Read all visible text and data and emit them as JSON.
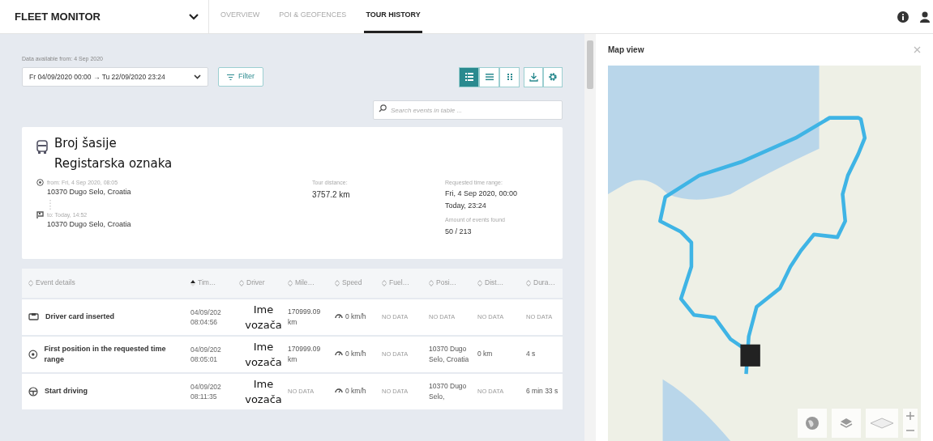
{
  "header": {
    "app_title": "FLEET MONITOR",
    "tabs": [
      {
        "label": "OVERVIEW",
        "selected": false
      },
      {
        "label": "POI & GEOFENCES",
        "selected": false
      },
      {
        "label": "TOUR HISTORY",
        "selected": true
      }
    ]
  },
  "toolbar": {
    "data_available": "Data available from: 4 Sep 2020",
    "date_range": "Fr 04/09/2020 00:00 → Tu 22/09/2020 23:24",
    "filter": "Filter",
    "view_modes": [
      {
        "kind": "detailed",
        "selected": true
      },
      {
        "kind": "list",
        "selected": false
      },
      {
        "kind": "grid",
        "selected": false
      }
    ],
    "search_placeholder": "Search events in table ..."
  },
  "summary": {
    "vehicle_lines": [
      "Broj šasije",
      "Registarska oznaka"
    ],
    "from_label": "from: Fri, 4 Sep 2020, 08:05",
    "from_place": "10370 Dugo Selo, Croatia",
    "to_label": "to: Today, 14:52",
    "to_place": "10370 Dugo Selo, Croatia",
    "distance_label": "Tour distance:",
    "distance": "3757.2 km",
    "range_label": "Requested time range:",
    "range_start": "Fri, 4 Sep 2020, 00:00",
    "range_end": "Today, 23:24",
    "events_label": "Amount of events found",
    "events": "50 / 213"
  },
  "table": {
    "columns": [
      {
        "label": "Event details",
        "sorted": false
      },
      {
        "label": "Tim…",
        "sorted": true
      },
      {
        "label": "Driver",
        "sorted": false
      },
      {
        "label": "Mile…",
        "sorted": false
      },
      {
        "label": "Speed",
        "sorted": false
      },
      {
        "label": "Fuel…",
        "sorted": false
      },
      {
        "label": "Posi…",
        "sorted": false
      },
      {
        "label": "Dist…",
        "sorted": false
      },
      {
        "label": "Dura…",
        "sorted": false
      }
    ],
    "rows": [
      {
        "kind": "card",
        "cells": [
          {
            "kind": "event",
            "text": "Driver card inserted"
          },
          {
            "kind": "datetime",
            "date": "04/09/202",
            "time": "08:04:56"
          },
          {
            "kind": "driver",
            "text": "Ime vozača"
          },
          {
            "kind": "value",
            "text": "170999.09 km"
          },
          {
            "kind": "speed",
            "text": "0 km/h"
          },
          {
            "kind": "no_data",
            "text": "NO DATA"
          },
          {
            "kind": "no_data",
            "text": "NO DATA"
          },
          {
            "kind": "no_data",
            "text": "NO DATA"
          },
          {
            "kind": "no_data",
            "text": "NO DATA"
          }
        ]
      },
      {
        "kind": "position",
        "cells": [
          {
            "kind": "event",
            "text": "First position in the requested time range"
          },
          {
            "kind": "datetime",
            "date": "04/09/202",
            "time": "08:05:01"
          },
          {
            "kind": "driver",
            "text": "Ime vozača"
          },
          {
            "kind": "value",
            "text": "170999.09 km"
          },
          {
            "kind": "speed",
            "text": "0 km/h"
          },
          {
            "kind": "no_data",
            "text": "NO DATA"
          },
          {
            "kind": "value",
            "text": "10370 Dugo Selo, Croatia"
          },
          {
            "kind": "value",
            "text": "0 km"
          },
          {
            "kind": "value",
            "text": "4 s"
          }
        ]
      },
      {
        "kind": "driving",
        "cells": [
          {
            "kind": "event",
            "text": "Start driving"
          },
          {
            "kind": "datetime",
            "date": "04/09/202",
            "time": "08:11:35"
          },
          {
            "kind": "driver",
            "text": "Ime vozača"
          },
          {
            "kind": "no_data",
            "text": "NO DATA"
          },
          {
            "kind": "speed",
            "text": "0 km/h"
          },
          {
            "kind": "no_data",
            "text": "NO DATA"
          },
          {
            "kind": "value",
            "text": "10370 Dugo Selo,"
          },
          {
            "kind": "no_data",
            "text": "NO DATA"
          },
          {
            "kind": "value",
            "text": "6 min 33 s"
          }
        ]
      }
    ]
  },
  "map": {
    "title": "Map view"
  }
}
